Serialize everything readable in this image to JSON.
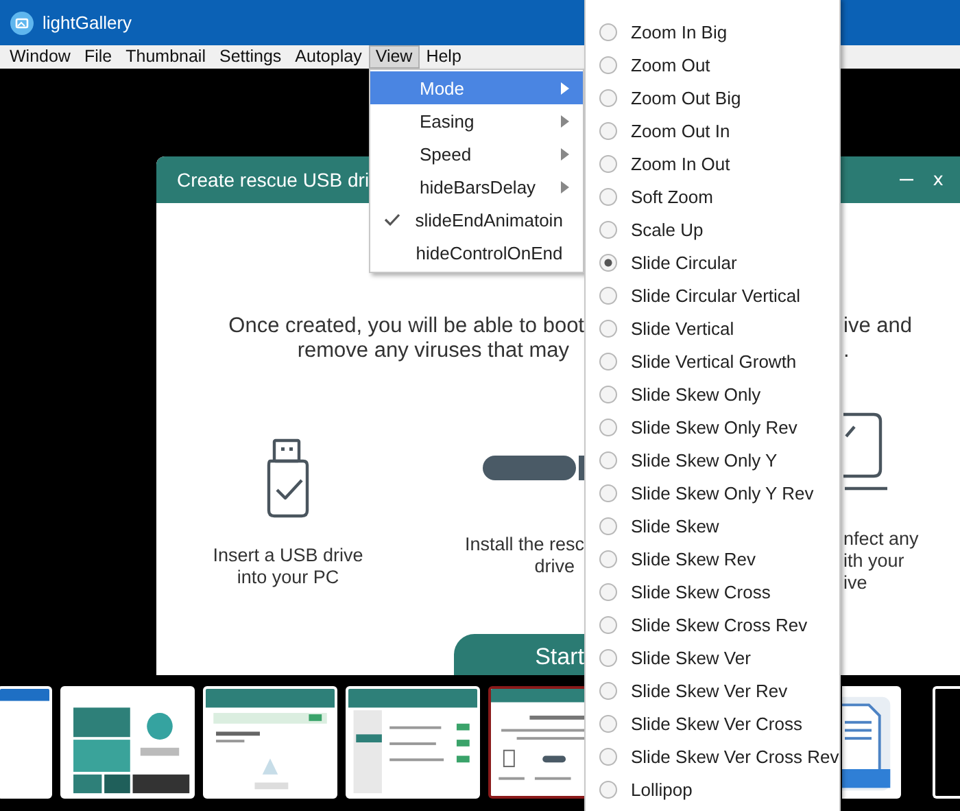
{
  "window": {
    "title": "lightGallery"
  },
  "menu_bar": [
    {
      "label": "Window",
      "selected": false
    },
    {
      "label": "File",
      "selected": false
    },
    {
      "label": "Thumbnail",
      "selected": false
    },
    {
      "label": "Settings",
      "selected": false
    },
    {
      "label": "Autoplay",
      "selected": false
    },
    {
      "label": "View",
      "selected": true
    },
    {
      "label": "Help",
      "selected": false
    }
  ],
  "view_menu": [
    {
      "label": "Mode",
      "kind": "submenu",
      "selected": true
    },
    {
      "label": "Easing",
      "kind": "submenu",
      "selected": false
    },
    {
      "label": "Speed",
      "kind": "submenu",
      "selected": false
    },
    {
      "label": "hideBarsDelay",
      "kind": "submenu",
      "selected": false
    },
    {
      "label": "slideEndAnimatoin",
      "kind": "toggle",
      "selected": false,
      "checked": true
    },
    {
      "label": "hideControlOnEnd",
      "kind": "toggle",
      "selected": false,
      "checked": false
    }
  ],
  "mode_submenu": [
    {
      "label": "Zoom In Big",
      "selected": false
    },
    {
      "label": "Zoom Out",
      "selected": false
    },
    {
      "label": "Zoom Out Big",
      "selected": false
    },
    {
      "label": "Zoom Out In",
      "selected": false
    },
    {
      "label": "Zoom In Out",
      "selected": false
    },
    {
      "label": "Soft Zoom",
      "selected": false
    },
    {
      "label": "Scale Up",
      "selected": false
    },
    {
      "label": "Slide Circular",
      "selected": true
    },
    {
      "label": "Slide Circular Vertical",
      "selected": false
    },
    {
      "label": "Slide Vertical",
      "selected": false
    },
    {
      "label": "Slide Vertical Growth",
      "selected": false
    },
    {
      "label": "Slide Skew Only",
      "selected": false
    },
    {
      "label": "Slide Skew Only Rev",
      "selected": false
    },
    {
      "label": "Slide Skew Only Y",
      "selected": false
    },
    {
      "label": "Slide Skew Only Y Rev",
      "selected": false
    },
    {
      "label": "Slide Skew",
      "selected": false
    },
    {
      "label": "Slide Skew Rev",
      "selected": false
    },
    {
      "label": "Slide Skew Cross",
      "selected": false
    },
    {
      "label": "Slide Skew Cross Rev",
      "selected": false
    },
    {
      "label": "Slide Skew Ver",
      "selected": false
    },
    {
      "label": "Slide Skew Ver Rev",
      "selected": false
    },
    {
      "label": "Slide Skew Ver Cross",
      "selected": false
    },
    {
      "label": "Slide Skew Ver Cross Rev",
      "selected": false
    },
    {
      "label": "Lollipop",
      "selected": false
    }
  ],
  "dialog": {
    "title": "Create rescue USB dri",
    "close": "x",
    "intro_left": [
      "Once created, you will be able to boot",
      "remove any viruses that may"
    ],
    "intro_right": [
      "ive and",
      "."
    ],
    "steps": [
      {
        "kind": "usb",
        "lines": [
          "Insert a USB drive",
          "into your PC"
        ]
      },
      {
        "kind": "install",
        "lines": [
          "Install the resc",
          "drive"
        ]
      }
    ],
    "step_right": [
      "nfect any",
      "ith your",
      "ive"
    ],
    "start_button": "Start"
  },
  "thumbnails": [
    {
      "kind": "list",
      "selected": false
    },
    {
      "kind": "dashboard",
      "selected": false
    },
    {
      "kind": "form",
      "selected": false
    },
    {
      "kind": "settings",
      "selected": false
    },
    {
      "kind": "dialog",
      "selected": true
    },
    {
      "kind": "document",
      "selected": false
    },
    {
      "kind": "dark",
      "selected": false
    }
  ]
}
